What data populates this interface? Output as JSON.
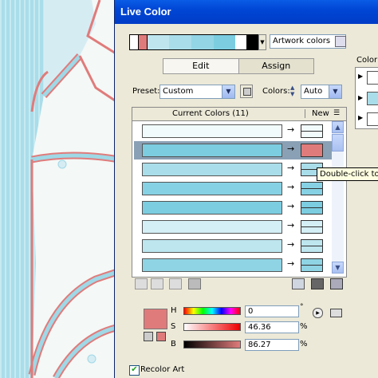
{
  "window": {
    "title": "Live Color"
  },
  "top": {
    "swatches": [
      "#ffffff",
      "#e07b7b",
      "#bfe6ef",
      "#a9dde9",
      "#93d5e5",
      "#7ccde0",
      "#ffffff",
      "#000000"
    ],
    "artwork_select": "Artwork colors"
  },
  "tabs": [
    {
      "label": "Edit",
      "active": true
    },
    {
      "label": "Assign",
      "active": false
    }
  ],
  "preset": {
    "label": "Preset:",
    "value": "Custom"
  },
  "colors": {
    "label": "Colors:",
    "value": "Auto"
  },
  "table": {
    "header_current": "Current Colors (11)",
    "header_new": "New",
    "rows": [
      {
        "current": "#f2fbfc",
        "new": "#f2fbfc",
        "selected": false
      },
      {
        "current": "#7ccde0",
        "new": "#e07b7b",
        "selected": true
      },
      {
        "current": "#a9dde9",
        "new": "#a9dde9",
        "selected": false
      },
      {
        "current": "#86d1e3",
        "new": "#86d1e3",
        "selected": false
      },
      {
        "current": "#7ccde0",
        "new": "#7ccde0",
        "selected": false
      },
      {
        "current": "#d4eff5",
        "new": "#d4eff5",
        "selected": false
      },
      {
        "current": "#bde6ef",
        "new": "#bde6ef",
        "selected": false
      },
      {
        "current": "#8fd4e4",
        "new": "#8fd4e4",
        "selected": false
      }
    ]
  },
  "tooltip": "Double-click to e",
  "hsb": {
    "current_color": "#e07b7b",
    "h_label": "H",
    "h_value": "0",
    "s_label": "S",
    "s_value": "46.36",
    "s_unit": "%",
    "b_label": "B",
    "b_value": "86.27",
    "b_unit": "%"
  },
  "recolor": {
    "label": "Recolor Art",
    "checked": true
  },
  "right_panel": {
    "label": "Color",
    "swatch_colors": [
      "#ffffff",
      "#a9dde9",
      "#ffffff"
    ]
  },
  "accent": {
    "title_bar": "#0046d5",
    "selection": "#8aa0b4"
  }
}
